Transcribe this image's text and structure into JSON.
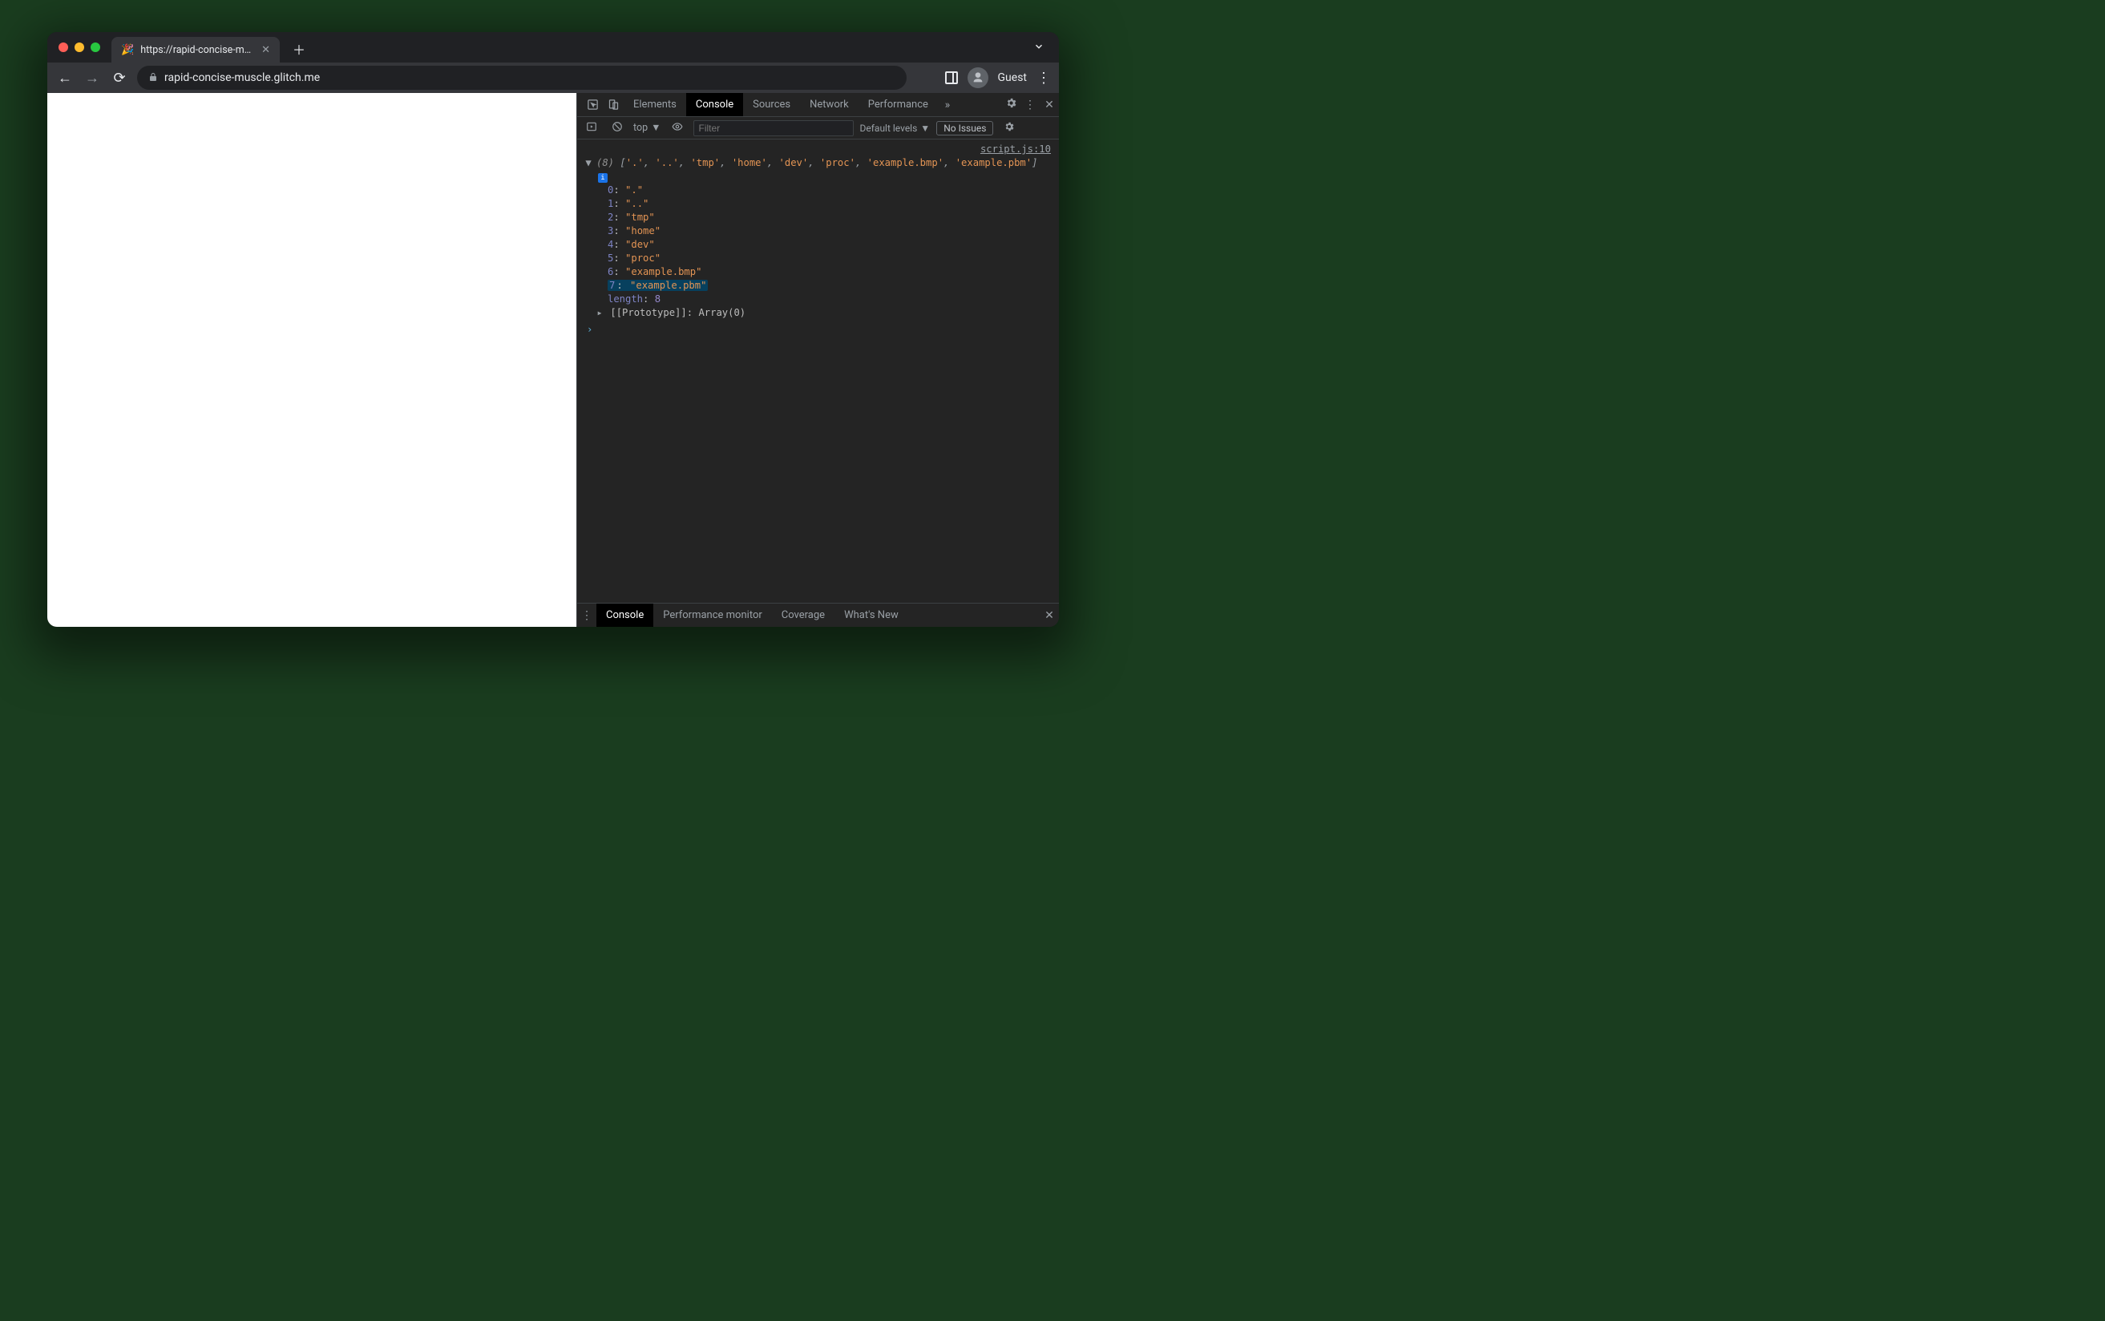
{
  "browser": {
    "tab_title": "https://rapid-concise-muscle.g",
    "favicon": "🎉",
    "url_display": "rapid-concise-muscle.glitch.me",
    "profile_label": "Guest"
  },
  "devtools": {
    "tabs": {
      "elements": "Elements",
      "console": "Console",
      "sources": "Sources",
      "network": "Network",
      "performance": "Performance"
    },
    "subbar": {
      "context": "top",
      "filter_placeholder": "Filter",
      "levels": "Default levels",
      "issues": "No Issues"
    },
    "source_link": "script.js:10",
    "array_summary": {
      "length_display": "(8)",
      "items": [
        ".",
        "..",
        "tmp",
        "home",
        "dev",
        "proc",
        "example.bmp",
        "example.pbm"
      ]
    },
    "array_entries": [
      {
        "idx": "0",
        "val": "."
      },
      {
        "idx": "1",
        "val": ".."
      },
      {
        "idx": "2",
        "val": "tmp"
      },
      {
        "idx": "3",
        "val": "home"
      },
      {
        "idx": "4",
        "val": "dev"
      },
      {
        "idx": "5",
        "val": "proc"
      },
      {
        "idx": "6",
        "val": "example.bmp"
      },
      {
        "idx": "7",
        "val": "example.pbm"
      }
    ],
    "length_label": "length",
    "length_value": "8",
    "prototype_label": "[[Prototype]]",
    "prototype_value": "Array(0)",
    "drawer_tabs": {
      "console": "Console",
      "perf_monitor": "Performance monitor",
      "coverage": "Coverage",
      "whats_new": "What's New"
    }
  }
}
